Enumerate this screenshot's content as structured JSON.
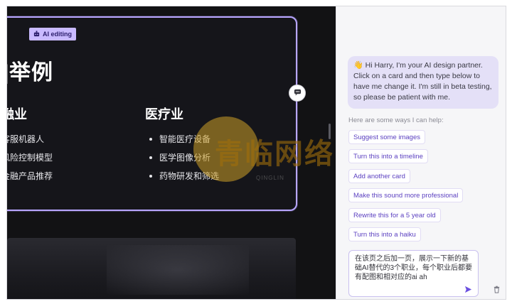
{
  "canvas": {
    "ai_badge": "AI editing",
    "card_title": "]举例",
    "columns": [
      {
        "heading": "融业",
        "items": [
          "客服机器人",
          "风险控制模型",
          "金融产品推荐"
        ]
      },
      {
        "heading": "医疗业",
        "items": [
          "智能医疗设备",
          "医学图像分析",
          "药物研发和筛选"
        ]
      }
    ]
  },
  "panel": {
    "greeting_emoji": "👋",
    "greeting": "Hi Harry, I'm your AI design partner. Click on a card and then type below to have me change it. I'm still in beta testing, so please be patient with me.",
    "help_label": "Here are some ways I can help:",
    "suggestions": [
      "Suggest some images",
      "Turn this into a timeline",
      "Add another card",
      "Make this sound more professional",
      "Rewrite this for a 5 year old",
      "Turn this into a haiku"
    ],
    "input_text": "在该页之后加一页，展示一下新的基础AI替代的3个职业，每个职业后都要有配图和相对应的ai ah"
  },
  "watermark": {
    "text": "青临网络",
    "subtext": "QINGLIN"
  },
  "colors": {
    "accent": "#b8a6ff",
    "badge_bg": "#c9baff",
    "suggestion_text": "#5a3fc0",
    "greeting_bg": "#e4e0f7"
  },
  "icons": {
    "badge": "ai-sparkle-icon",
    "connector": "comment-icon",
    "send": "send-arrow-icon",
    "trash": "trash-icon"
  }
}
